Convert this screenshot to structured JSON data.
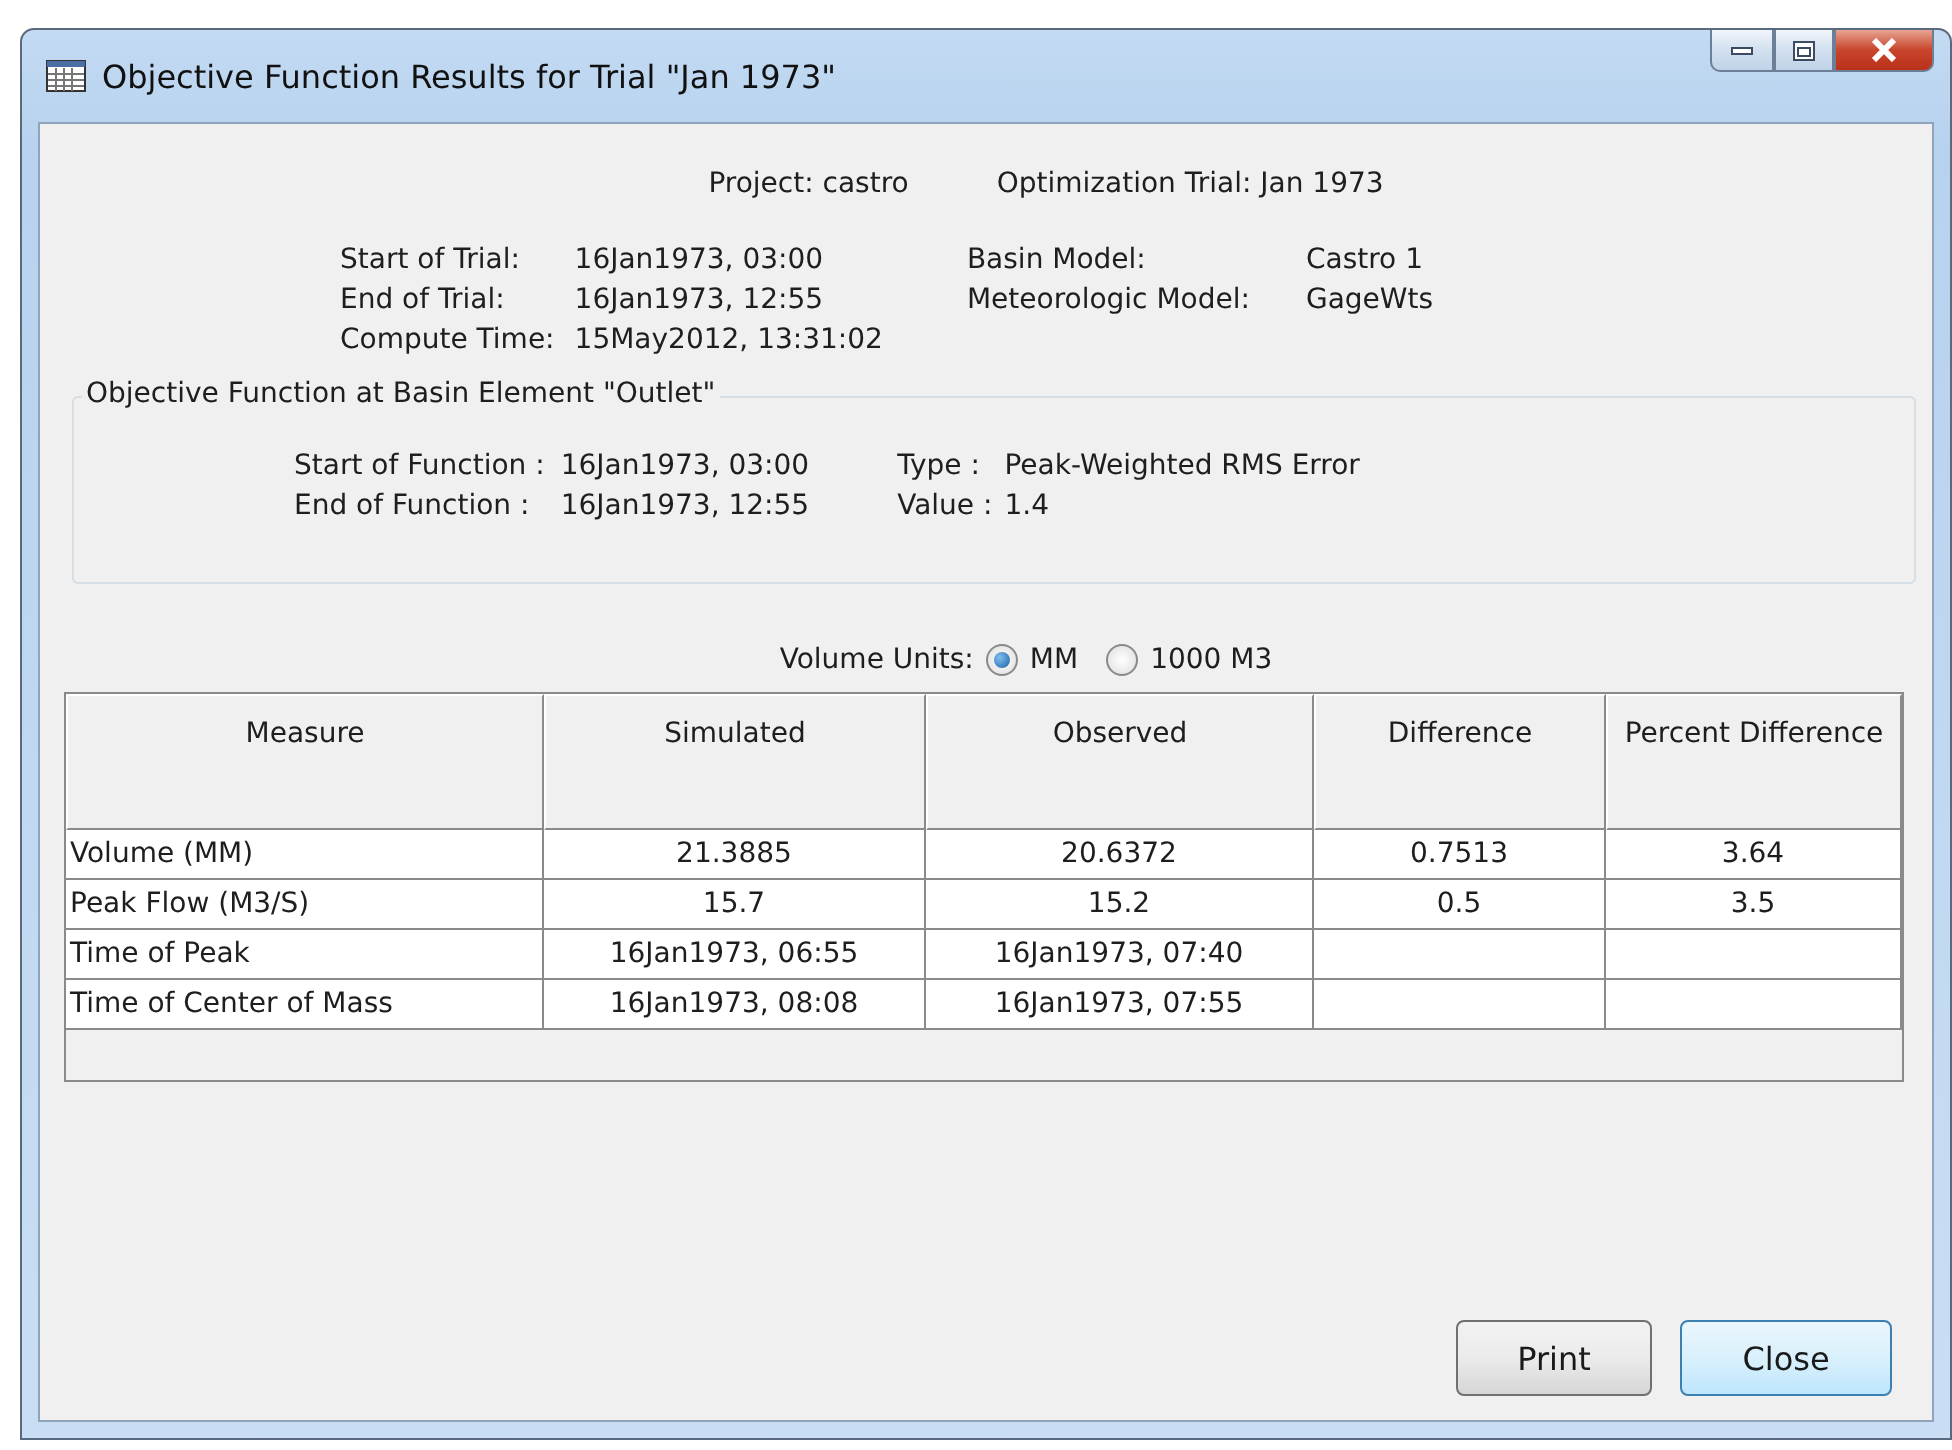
{
  "window": {
    "title": "Objective Function Results for Trial \"Jan 1973\""
  },
  "header": {
    "project": "Project: castro",
    "trial": "Optimization Trial: Jan 1973"
  },
  "trial_info": {
    "left": [
      {
        "label": "Start of Trial:",
        "value": "16Jan1973, 03:00"
      },
      {
        "label": "End of Trial:",
        "value": "16Jan1973, 12:55"
      },
      {
        "label": "Compute Time:",
        "value": "15May2012, 13:31:02"
      }
    ],
    "right": [
      {
        "label": "Basin Model:",
        "value": "Castro 1"
      },
      {
        "label": "Meteorologic Model:",
        "value": "GageWts"
      }
    ]
  },
  "objective_group": {
    "title": "Objective Function at Basin Element \"Outlet\"",
    "left": [
      {
        "label": "Start of Function :",
        "value": "16Jan1973, 03:00"
      },
      {
        "label": "End of Function :",
        "value": "16Jan1973, 12:55"
      }
    ],
    "right": [
      {
        "label": "Type :",
        "value": "Peak-Weighted RMS Error"
      },
      {
        "label": "Value :",
        "value": "1.4"
      }
    ]
  },
  "volume_units": {
    "label": "Volume Units:",
    "options": [
      {
        "label": "MM",
        "selected": true
      },
      {
        "label": "1000 M3",
        "selected": false
      }
    ]
  },
  "table": {
    "columns": [
      "Measure",
      "Simulated",
      "Observed",
      "Difference",
      "Percent Difference"
    ],
    "rows": [
      [
        "Volume (MM)",
        "21.3885",
        "20.6372",
        "0.7513",
        "3.64"
      ],
      [
        "Peak Flow (M3/S)",
        "15.7",
        "15.2",
        "0.5",
        "3.5"
      ],
      [
        "Time of Peak",
        "16Jan1973, 06:55",
        "16Jan1973, 07:40",
        "",
        ""
      ],
      [
        "Time of Center of Mass",
        "16Jan1973, 08:08",
        "16Jan1973, 07:55",
        "",
        ""
      ]
    ]
  },
  "buttons": [
    {
      "label": "Print",
      "default": false
    },
    {
      "label": "Close",
      "default": true
    }
  ]
}
